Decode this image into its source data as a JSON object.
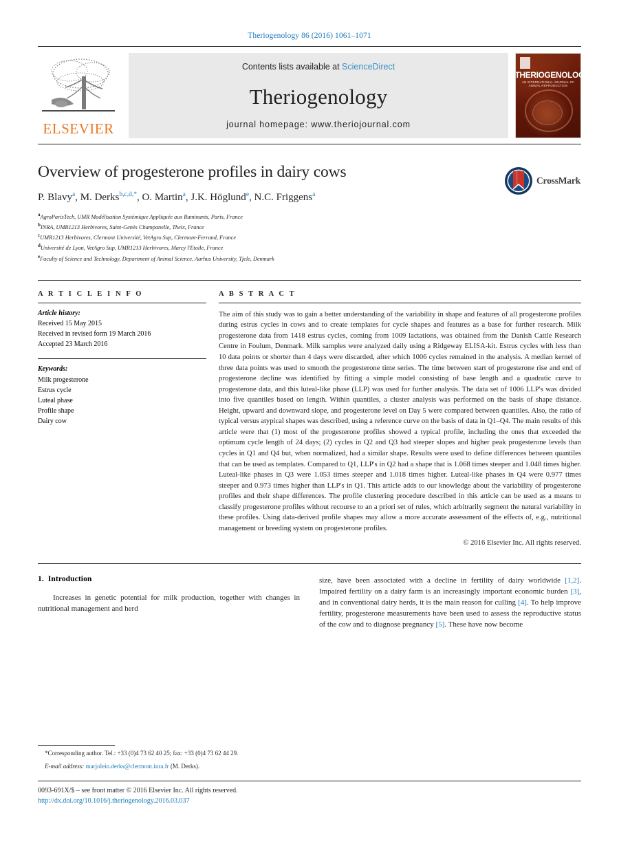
{
  "running_head": "Theriogenology 86 (2016) 1061–1071",
  "masthead": {
    "publisher_wordmark": "ELSEVIER",
    "contents_prefix": "Contents lists available at ",
    "contents_link": "ScienceDirect",
    "journal_name": "Theriogenology",
    "homepage": "journal homepage: www.theriojournal.com",
    "cover_title": "THERIOGENOLOGY",
    "cover_subtitle": "AN INTERNATIONAL JOURNAL OF ANIMAL REPRODUCTION"
  },
  "crossmark": {
    "label": "CrossMark"
  },
  "article": {
    "title": "Overview of progesterone profiles in dairy cows",
    "authors": [
      {
        "name": "P. Blavy",
        "sup": "a",
        "corresponding": false
      },
      {
        "name": "M. Derks",
        "sup": "b,c,d,",
        "corresponding": true
      },
      {
        "name": "O. Martin",
        "sup": "a",
        "corresponding": false
      },
      {
        "name": "J.K. Höglund",
        "sup": "e",
        "corresponding": false
      },
      {
        "name": "N.C. Friggens",
        "sup": "a",
        "corresponding": false
      }
    ],
    "affiliations": [
      {
        "mark": "a",
        "text": "AgroParisTech, UMR Modélisation Systémique Appliquée aux Ruminants, Paris, France"
      },
      {
        "mark": "b",
        "text": "INRA, UMR1213 Herbivores, Saint-Genès Champanelle, Theix, France"
      },
      {
        "mark": "c",
        "text": "UMR1213 Herbivores, Clermont Université, VetAgro Sup, Clermont-Ferrand, France"
      },
      {
        "mark": "d",
        "text": "Université de Lyon, VetAgro Sup, UMR1213 Herbivores, Marcy l'Etoile, France"
      },
      {
        "mark": "e",
        "text": "Faculty of Science and Technology, Department of Animal Science, Aarhus University, Tjele, Denmark"
      }
    ]
  },
  "article_info": {
    "heading": "A R T I C L E  I N F O",
    "history_label": "Article history:",
    "history": [
      "Received 15 May 2015",
      "Received in revised form 19 March 2016",
      "Accepted 23 March 2016"
    ],
    "keywords_label": "Keywords:",
    "keywords": [
      "Milk progesterone",
      "Estrus cycle",
      "Luteal phase",
      "Profile shape",
      "Dairy cow"
    ]
  },
  "abstract": {
    "heading": "A B S T R A C T",
    "text": "The aim of this study was to gain a better understanding of the variability in shape and features of all progesterone profiles during estrus cycles in cows and to create templates for cycle shapes and features as a base for further research. Milk progesterone data from 1418 estrus cycles, coming from 1009 lactations, was obtained from the Danish Cattle Research Centre in Foulum, Denmark. Milk samples were analyzed daily using a Ridgeway ELISA-kit. Estrus cycles with less than 10 data points or shorter than 4 days were discarded, after which 1006 cycles remained in the analysis. A median kernel of three data points was used to smooth the progesterone time series. The time between start of progesterone rise and end of progesterone decline was identified by fitting a simple model consisting of base length and a quadratic curve to progesterone data, and this luteal-like phase (LLP) was used for further analysis. The data set of 1006 LLP's was divided into five quantiles based on length. Within quantiles, a cluster analysis was performed on the basis of shape distance. Height, upward and downward slope, and progesterone level on Day 5 were compared between quantiles. Also, the ratio of typical versus atypical shapes was described, using a reference curve on the basis of data in Q1–Q4. The main results of this article were that (1) most of the progesterone profiles showed a typical profile, including the ones that exceeded the optimum cycle length of 24 days; (2) cycles in Q2 and Q3 had steeper slopes and higher peak progesterone levels than cycles in Q1 and Q4 but, when normalized, had a similar shape. Results were used to define differences between quantiles that can be used as templates. Compared to Q1, LLP's in Q2 had a shape that is 1.068 times steeper and 1.048 times higher. Luteal-like phases in Q3 were 1.053 times steeper and 1.018 times higher. Luteal-like phases in Q4 were 0.977 times steeper and 0.973 times higher than LLP's in Q1. This article adds to our knowledge about the variability of progesterone profiles and their shape differences. The profile clustering procedure described in this article can be used as a means to classify progesterone profiles without recourse to an a priori set of rules, which arbitrarily segment the natural variability in these profiles. Using data-derived profile shapes may allow a more accurate assessment of the effects of, e.g., nutritional management or breeding system on progesterone profiles.",
    "copyright": "© 2016 Elsevier Inc. All rights reserved."
  },
  "body": {
    "section_number": "1.",
    "section_title": "Introduction",
    "left_paragraph": "Increases in genetic potential for milk production, together with changes in nutritional management and herd",
    "right_parts": [
      {
        "t": "size, have been associated with a decline in fertility of dairy worldwide ",
        "cite": false
      },
      {
        "t": "[1,2]",
        "cite": true
      },
      {
        "t": ". Impaired fertility on a dairy farm is an increasingly important economic burden ",
        "cite": false
      },
      {
        "t": "[3]",
        "cite": true
      },
      {
        "t": ", and in conventional dairy herds, it is the main reason for culling ",
        "cite": false
      },
      {
        "t": "[4]",
        "cite": true
      },
      {
        "t": ". To help improve fertility, progesterone measurements have been used to assess the reproductive status of the cow and to diagnose pregnancy ",
        "cite": false
      },
      {
        "t": "[5]",
        "cite": true
      },
      {
        "t": ". These have now become",
        "cite": false
      }
    ]
  },
  "footnote": {
    "corresponding": "*Corresponding author. Tel.: +33 (0)4 73 62 40 25; fax: +33 (0)4 73 62 44 29.",
    "email_label": "E-mail address: ",
    "email": "marjolein.derks@clermont.inra.fr",
    "email_suffix": " (M. Derks)."
  },
  "footer": {
    "issn": "0093-691X/$ – see front matter © 2016 Elsevier Inc. All rights reserved.",
    "doi": "http://dx.doi.org/10.1016/j.theriogenology.2016.03.037"
  },
  "colors": {
    "link": "#1a7bb9",
    "elsevier_orange": "#e87722",
    "banner_gray": "#e9e9e9"
  }
}
